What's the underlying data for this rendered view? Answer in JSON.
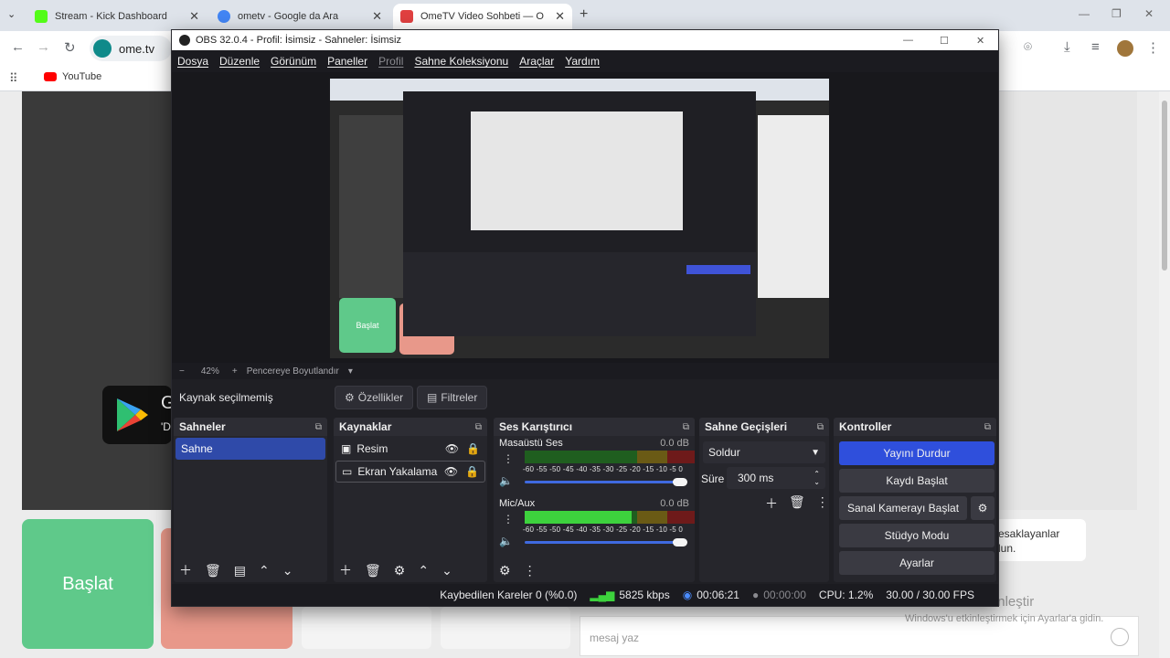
{
  "browser": {
    "tabs": [
      {
        "title": "Stream - Kick Dashboard",
        "fav_color": "#53fc18"
      },
      {
        "title": "ometv - Google da Ara",
        "fav_color": "#4285f4"
      },
      {
        "title": "OmeTV Video Sohbeti — O",
        "fav_color": "#e04040"
      }
    ],
    "new_tab": "+",
    "address": "ome.tv",
    "bookmark": "YouTube",
    "minimize": "—",
    "restore": "❐",
    "close": "✕"
  },
  "page": {
    "start_label": "Başlat",
    "chat_notice_lines": [
      "esaklayanlar",
      "lun."
    ],
    "message_placeholder": "mesaj yaz",
    "activate_title": "Windows'u Etkinleştir",
    "activate_sub": "Windows'u etkinleştirmek için Ayarlar'a gidin.",
    "play_letter": "G",
    "play_letter2": "'D"
  },
  "obs": {
    "title": "OBS 32.0.4 - Profil: İsimsiz - Sahneler: İsimsiz",
    "menu": [
      "Dosya",
      "Düzenle",
      "Görünüm",
      "Paneller",
      "Profil",
      "Sahne Koleksiyonu",
      "Araçlar",
      "Yardım"
    ],
    "zoom": {
      "minus": "−",
      "value": "42%",
      "plus": "+",
      "fit": "Pencereye Boyutlandır"
    },
    "no_source": "Kaynak seçilmemiş",
    "properties": "Özellikler",
    "filters": "Filtreler",
    "scenes": {
      "title": "Sahneler",
      "items": [
        "Sahne"
      ]
    },
    "sources": {
      "title": "Kaynaklar",
      "items": [
        "Resim",
        "Ekran Yakalama"
      ]
    },
    "mixer": {
      "title": "Ses Karıştırıcı",
      "channels": [
        {
          "name": "Masaüstü Ses",
          "db": "0.0 dB",
          "level": 0.0
        },
        {
          "name": "Mic/Aux",
          "db": "0.0 dB",
          "level": 0.63
        }
      ],
      "scale": "-60 -55 -50 -45 -40 -35 -30 -25 -20 -15 -10 -5 0"
    },
    "transitions": {
      "title": "Sahne Geçişleri",
      "type": "Soldur",
      "duration_label": "Süre",
      "duration": "300 ms"
    },
    "controls": {
      "title": "Kontroller",
      "buttons": [
        "Yayını Durdur",
        "Kaydı Başlat",
        "Sanal Kamerayı Başlat",
        "Stüdyo Modu",
        "Ayarlar"
      ]
    },
    "status": {
      "dropped": "Kaybedilen Kareler 0 (%0.0)",
      "bitrate": "5825 kbps",
      "stream_time": "00:06:21",
      "rec_time": "00:00:00",
      "cpu": "CPU: 1.2%",
      "fps": "30.00 / 30.00 FPS"
    }
  }
}
